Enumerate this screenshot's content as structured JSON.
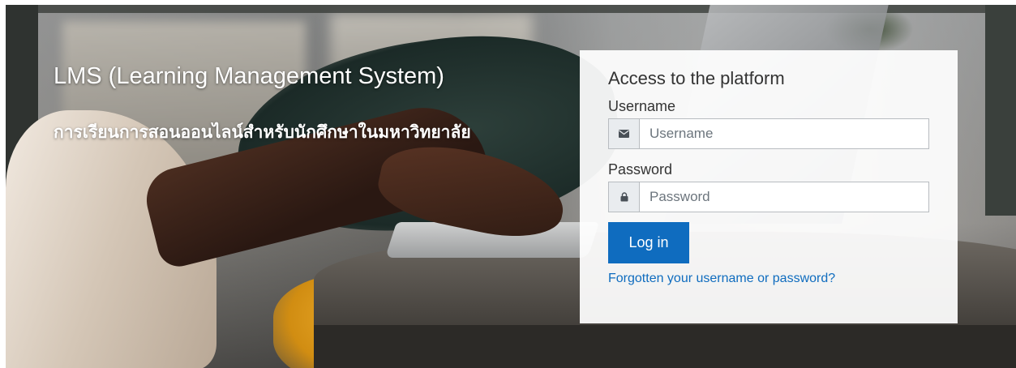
{
  "hero": {
    "title": "LMS (Learning Management System)",
    "subtitle": "การเรียนการสอนออนไลน์สำหรับนักศึกษาในมหาวิทยาลัย"
  },
  "login": {
    "title": "Access to the platform",
    "username_label": "Username",
    "username_placeholder": "Username",
    "username_icon": "envelope-icon",
    "password_label": "Password",
    "password_placeholder": "Password",
    "password_icon": "lock-icon",
    "login_button": "Log in",
    "forgot_link": "Forgotten your username or password?"
  },
  "colors": {
    "primary": "#0f6cbf",
    "card_bg": "#ffffff",
    "addon_bg": "#e9ecef"
  }
}
